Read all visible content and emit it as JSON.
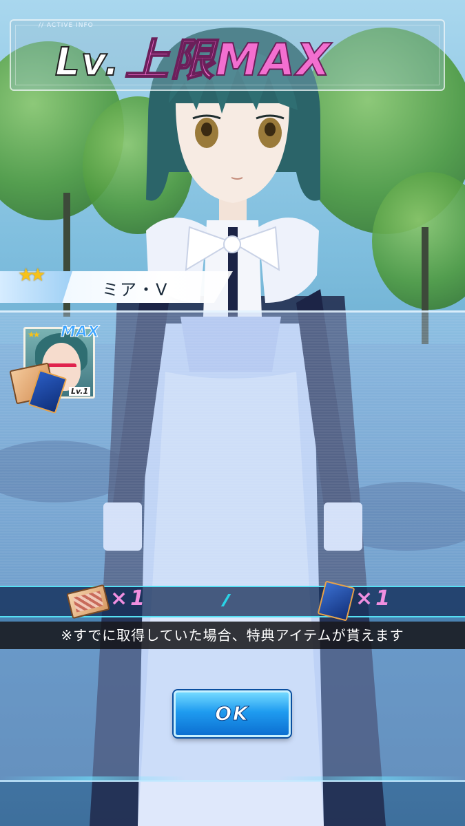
{
  "banner": {
    "tag": "// ACTIVE INFO",
    "lv": "Lv.",
    "title": "上限MAX"
  },
  "character": {
    "stars": "★★",
    "name": "ミア・V"
  },
  "card": {
    "stars": "★★",
    "max_label": "MAX",
    "level": "Lv.1"
  },
  "rewards": {
    "item_a_count": "×1",
    "item_b_count": "×1"
  },
  "note": "※すでに取得していた場合、特典アイテムが貰えます",
  "buttons": {
    "ok": "OK"
  },
  "colors": {
    "title_pink": "#f36fd0",
    "accent_cyan": "#55e0f5",
    "button_blue": "#1f9cf0"
  }
}
